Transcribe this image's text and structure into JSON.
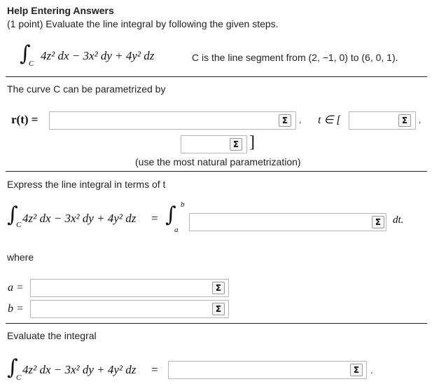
{
  "header": {
    "help_link": "Help Entering Answers",
    "prompt": "(1 point) Evaluate the line integral by following the given steps."
  },
  "integral": {
    "integrand": "4z² dx − 3x² dy + 4y² dz",
    "curve_subscript": "C",
    "curve_text": "C is the line segment from (2, −1, 0) to (6, 0, 1)."
  },
  "parametrize": {
    "intro": "The curve C can be parametrized by",
    "r_label": "r(t) =",
    "t_in": "t ∈ [",
    "hint": "(use the most natural parametrization)"
  },
  "express": {
    "intro": "Express the line integral in terms of t",
    "upper": "b",
    "lower": "a",
    "dt": "dt."
  },
  "where": {
    "label": "where",
    "a_label": "a =",
    "b_label": "b ="
  },
  "evaluate": {
    "intro": "Evaluate the integral"
  },
  "icons": {
    "equation_editor": "sigma-icon"
  },
  "inputs": {
    "r_t": "",
    "t_start": "",
    "t_end": "",
    "integrand_t": "",
    "a": "",
    "b": "",
    "result": ""
  }
}
